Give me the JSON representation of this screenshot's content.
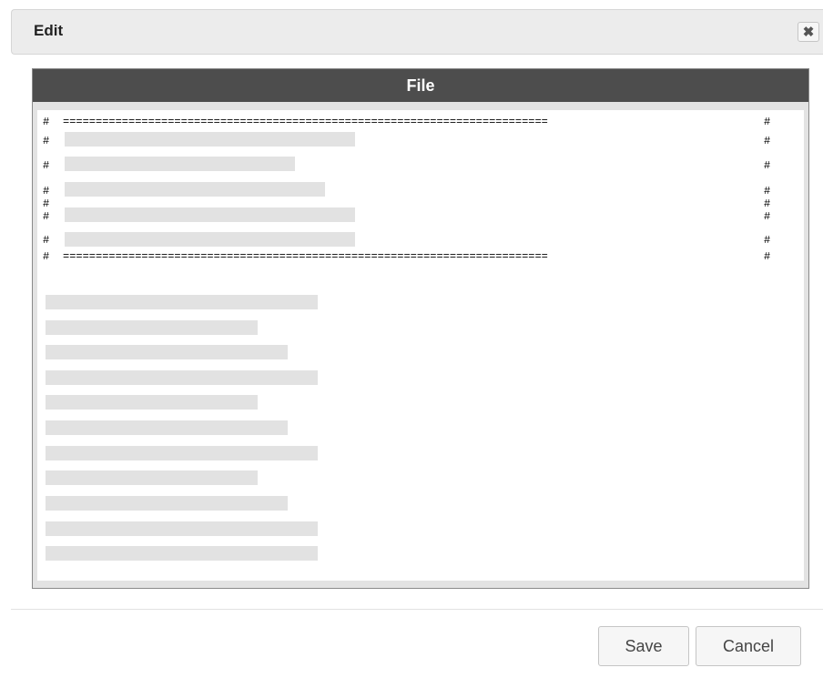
{
  "dialog": {
    "title": "Edit",
    "close_glyph": "✖",
    "close_icon": "close-icon"
  },
  "panel": {
    "header": "File"
  },
  "editor": {
    "comment_char": "#",
    "separator": "==========================================================================",
    "banner_lines": 5,
    "body_lines": 11
  },
  "footer": {
    "save_label": "Save",
    "cancel_label": "Cancel"
  },
  "colors": {
    "panel_header_bg": "#4d4d4d",
    "titlebar_bg": "#ececec",
    "redaction": "#e2e2e2"
  }
}
